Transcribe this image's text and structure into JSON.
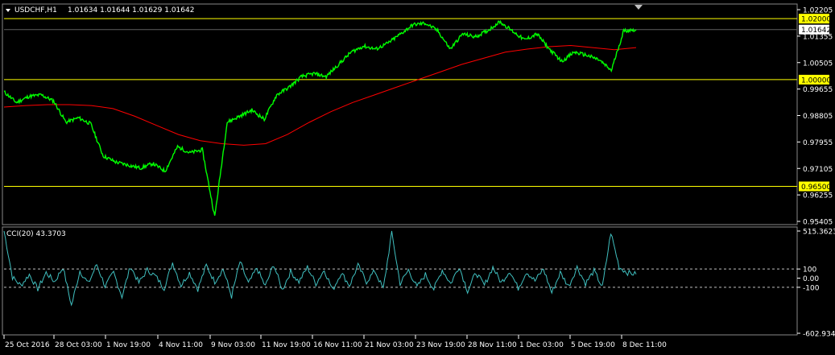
{
  "header": {
    "symbol": "USDCHF,H1",
    "ohlc": "1.01634 1.01644 1.01629 1.01642"
  },
  "indicator": {
    "label": "CCI(20) 43.3703"
  },
  "colors": {
    "background": "#000000",
    "price_line": "#00ff00",
    "ma_line": "#ff0000",
    "level_line": "#ffff00",
    "cci_line": "#40c0c0",
    "grid": "#606060",
    "text": "#ffffff"
  },
  "chart_data": [
    {
      "type": "line",
      "name": "price",
      "ylim": [
        0.953,
        1.024
      ],
      "y_ticks": [
        "1.02205",
        "1.01355",
        "1.00505",
        "0.99655",
        "0.98805",
        "0.97955",
        "0.97105",
        "0.96255",
        "0.95405"
      ],
      "x": [
        "25 Oct 2016",
        "28 Oct 03:00",
        "1 Nov 19:00",
        "4 Nov 11:00",
        "9 Nov 03:00",
        "11 Nov 19:00",
        "16 Nov 11:00",
        "21 Nov 03:00",
        "23 Nov 19:00",
        "28 Nov 11:00",
        "1 Dec 03:00",
        "5 Dec 19:00",
        "8 Dec 11:00"
      ],
      "series": [
        {
          "values": [
            0.996,
            0.9925,
            0.9945,
            0.995,
            0.993,
            0.986,
            0.9875,
            0.9855,
            0.975,
            0.973,
            0.972,
            0.971,
            0.9725,
            0.97,
            0.978,
            0.976,
            0.977,
            0.955,
            0.986,
            0.988,
            0.99,
            0.987,
            0.995,
            0.9975,
            1.001,
            1.002,
            1.001,
            1.005,
            1.009,
            1.011,
            1.01,
            1.012,
            1.015,
            1.018,
            1.0185,
            1.016,
            1.01,
            1.015,
            1.014,
            1.016,
            1.019,
            1.016,
            1.013,
            1.015,
            1.01,
            1.006,
            1.009,
            1.008,
            1.0065,
            1.003,
            1.016,
            1.0164
          ]
        },
        {
          "values": [
            0.991,
            0.9915,
            0.9918,
            0.9918,
            0.9915,
            0.9905,
            0.988,
            0.985,
            0.982,
            0.98,
            0.979,
            0.9785,
            0.979,
            0.982,
            0.986,
            0.9895,
            0.9925,
            0.995,
            0.9975,
            1.0,
            1.0025,
            1.005,
            1.007,
            1.009,
            1.01,
            1.0108,
            1.0112,
            1.0105,
            1.0098,
            1.0105
          ]
        }
      ],
      "levels": [
        {
          "value": 1.02,
          "label": "1.02000",
          "highlighted": true
        },
        {
          "value": 1.0,
          "label": "1.00000",
          "highlighted": true
        },
        {
          "value": 0.965,
          "label": "0.96500",
          "highlighted": true
        },
        {
          "value": 1.01642,
          "label": "1.01642",
          "highlighted": false
        }
      ]
    },
    {
      "type": "line",
      "name": "cci",
      "ylim": [
        -602.9342,
        515.3623
      ],
      "y_ticks": [
        "515.3623",
        "100",
        "0.00",
        "-100",
        "-602.9342"
      ],
      "levels": [
        100,
        -100
      ],
      "series": [
        {
          "values": [
            520,
            10,
            -80,
            40,
            -120,
            60,
            -40,
            120,
            -300,
            80,
            -60,
            150,
            -90,
            60,
            -200,
            130,
            -50,
            90,
            20,
            -110,
            170,
            -80,
            60,
            -120,
            140,
            -40,
            100,
            -200,
            180,
            -60,
            110,
            -90,
            150,
            -130,
            70,
            -40,
            120,
            -60,
            90,
            -130,
            60,
            -80,
            140,
            -40,
            80,
            -120,
            500,
            -60,
            90,
            -100,
            40,
            -120,
            90,
            -60,
            130,
            -140,
            60,
            -80,
            120,
            -50,
            80,
            -110,
            70,
            -30,
            100,
            -160,
            60,
            -90,
            120,
            -60,
            80,
            -100,
            500,
            120,
            60,
            43
          ]
        }
      ]
    }
  ]
}
